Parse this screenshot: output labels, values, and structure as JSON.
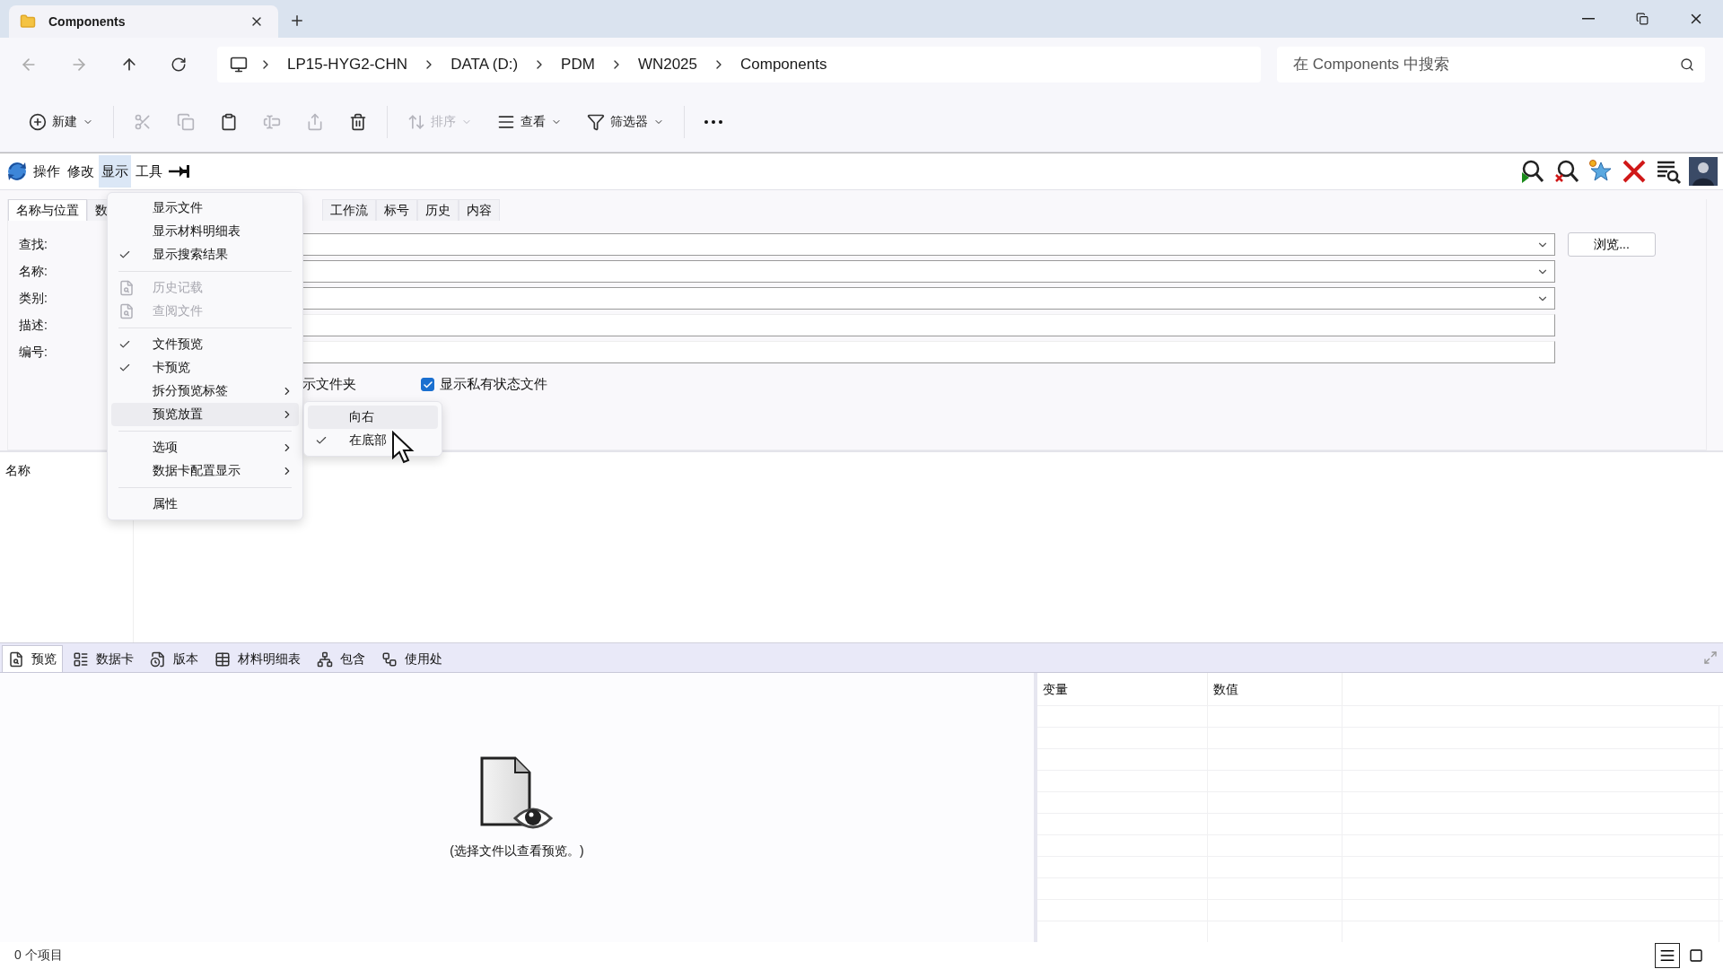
{
  "window": {
    "tab_title": "Components"
  },
  "address": {
    "crumbs": [
      "LP15-HYG2-CHN",
      "DATA (D:)",
      "PDM",
      "WN2025",
      "Components"
    ],
    "search_placeholder": "在 Components 中搜索"
  },
  "commands": [
    {
      "kind": "labeled",
      "label": "新建",
      "disabled": false,
      "dropdown": true
    },
    {
      "kind": "icon",
      "disabled": true
    },
    {
      "kind": "icon",
      "disabled": true
    },
    {
      "kind": "icon",
      "disabled": false
    },
    {
      "kind": "icon",
      "disabled": true
    },
    {
      "kind": "icon",
      "disabled": true
    },
    {
      "kind": "icon",
      "disabled": false
    },
    {
      "kind": "labeled",
      "label": "排序",
      "disabled": true,
      "dropdown": true
    },
    {
      "kind": "labeled",
      "label": "查看",
      "disabled": false,
      "dropdown": true
    },
    {
      "kind": "labeled",
      "label": "筛选器",
      "disabled": false,
      "dropdown": true
    },
    {
      "kind": "more",
      "disabled": false
    }
  ],
  "app_menu": [
    {
      "label": "操作",
      "selected": false
    },
    {
      "label": "修改",
      "selected": false
    },
    {
      "label": "显示",
      "selected": true
    },
    {
      "label": "工具",
      "selected": false
    }
  ],
  "form": {
    "tabs": [
      {
        "label": "名称与位置",
        "selected": true
      },
      {
        "label": "数",
        "selected": false
      },
      {
        "label": "工作流",
        "selected": false
      },
      {
        "label": "标号",
        "selected": false
      },
      {
        "label": "历史",
        "selected": false
      },
      {
        "label": "内容",
        "selected": false
      }
    ],
    "fields": [
      {
        "label": "查找:",
        "kind": "combo"
      },
      {
        "label": "名称:",
        "kind": "combo"
      },
      {
        "label": "类别:",
        "kind": "combo"
      },
      {
        "label": "描述:",
        "kind": "text"
      },
      {
        "label": "编号:",
        "kind": "text"
      }
    ],
    "browse_button": "浏览...",
    "options": [
      {
        "label": "示文件夹"
      },
      {
        "label": "显示私有状态文件",
        "checked": true
      }
    ]
  },
  "list": {
    "column": "名称"
  },
  "bottom_tabs": [
    {
      "label": "预览",
      "selected": true
    },
    {
      "label": "数据卡",
      "selected": false
    },
    {
      "label": "版本",
      "selected": false
    },
    {
      "label": "材料明细表",
      "selected": false
    },
    {
      "label": "包含",
      "selected": false
    },
    {
      "label": "使用处",
      "selected": false
    }
  ],
  "preview": {
    "message": "(选择文件以查看预览。)"
  },
  "variables_table": {
    "columns": [
      "变量",
      "数值"
    ]
  },
  "status_bar": {
    "count": "0 个项目"
  },
  "menu": {
    "items": [
      {
        "kind": "item",
        "label": "显示文件",
        "checked": false,
        "disabled": false,
        "submenu": false,
        "selected": false
      },
      {
        "kind": "item",
        "label": "显示材料明细表",
        "checked": false,
        "disabled": false,
        "submenu": false,
        "selected": false
      },
      {
        "kind": "item",
        "label": "显示搜索结果",
        "checked": true,
        "disabled": false,
        "submenu": false,
        "selected": false
      },
      {
        "kind": "separator"
      },
      {
        "kind": "item",
        "label": "历史记载",
        "checked": false,
        "disabled": true,
        "submenu": false,
        "selected": false
      },
      {
        "kind": "item",
        "label": "查阅文件",
        "checked": false,
        "disabled": true,
        "submenu": false,
        "selected": false
      },
      {
        "kind": "separator"
      },
      {
        "kind": "item",
        "label": "文件预览",
        "checked": true,
        "disabled": false,
        "submenu": false,
        "selected": false
      },
      {
        "kind": "item",
        "label": "卡预览",
        "checked": true,
        "disabled": false,
        "submenu": false,
        "selected": false
      },
      {
        "kind": "item",
        "label": "拆分预览标签",
        "checked": false,
        "disabled": false,
        "submenu": true,
        "selected": false
      },
      {
        "kind": "item",
        "label": "预览放置",
        "checked": false,
        "disabled": false,
        "submenu": true,
        "selected": true
      },
      {
        "kind": "separator"
      },
      {
        "kind": "item",
        "label": "选项",
        "checked": false,
        "disabled": false,
        "submenu": true,
        "selected": false
      },
      {
        "kind": "item",
        "label": "数据卡配置显示",
        "checked": false,
        "disabled": false,
        "submenu": true,
        "selected": false
      },
      {
        "kind": "separator"
      },
      {
        "kind": "item",
        "label": "属性",
        "checked": false,
        "disabled": false,
        "submenu": false,
        "selected": false
      }
    ]
  },
  "submenu": {
    "items": [
      {
        "label": "向右",
        "checked": false,
        "selected": true
      },
      {
        "label": "在底部",
        "checked": true,
        "selected": false
      }
    ]
  }
}
